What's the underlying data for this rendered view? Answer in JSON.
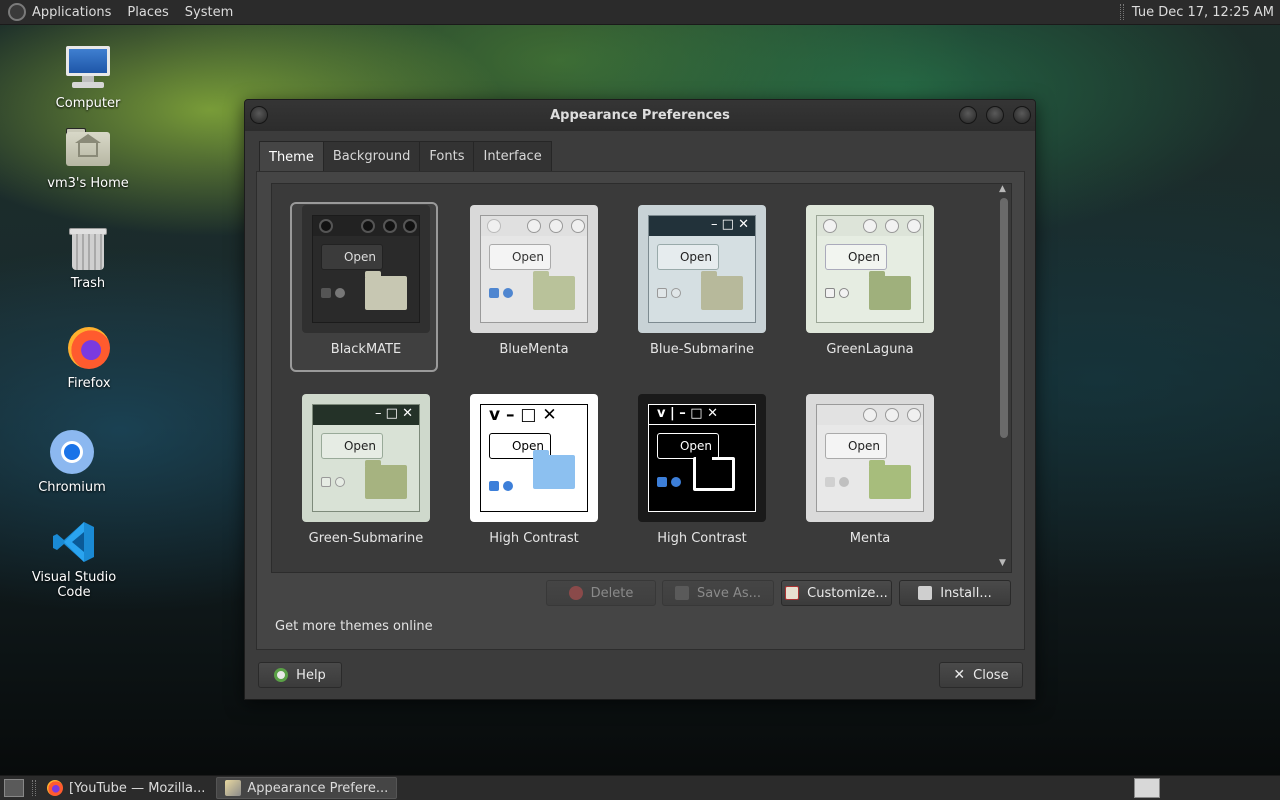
{
  "top_panel": {
    "menus": [
      "Applications",
      "Places",
      "System"
    ],
    "clock": "Tue Dec 17, 12:25 AM"
  },
  "desktop": {
    "icons": [
      {
        "label": "Computer",
        "icon": "computer-icon"
      },
      {
        "label": "vm3's Home",
        "icon": "home-folder-icon"
      },
      {
        "label": "Trash",
        "icon": "trash-icon"
      },
      {
        "label": "Firefox",
        "icon": "firefox-icon"
      },
      {
        "label": "Chromium",
        "icon": "chromium-icon"
      },
      {
        "label": "Visual Studio Code",
        "icon": "vscode-icon"
      }
    ]
  },
  "window": {
    "title": "Appearance Preferences",
    "tabs": [
      "Theme",
      "Background",
      "Fonts",
      "Interface"
    ],
    "active_tab": "Theme",
    "themes": [
      {
        "name": "BlackMATE",
        "selected": true,
        "open_label": "Open"
      },
      {
        "name": "BlueMenta",
        "selected": false,
        "open_label": "Open"
      },
      {
        "name": "Blue-Submarine",
        "selected": false,
        "open_label": "Open"
      },
      {
        "name": "GreenLaguna",
        "selected": false,
        "open_label": "Open"
      },
      {
        "name": "Green-Submarine",
        "selected": false,
        "open_label": "Open"
      },
      {
        "name": "High Contrast",
        "selected": false,
        "open_label": "Open"
      },
      {
        "name": "High Contrast",
        "selected": false,
        "open_label": "Open"
      },
      {
        "name": "Menta",
        "selected": false,
        "open_label": "Open"
      }
    ],
    "buttons": {
      "delete": "Delete",
      "save_as": "Save As...",
      "customize": "Customize...",
      "install": "Install..."
    },
    "more_themes": "Get more themes online",
    "help": "Help",
    "close": "Close"
  },
  "taskbar": {
    "tasks": [
      {
        "label": "[YouTube — Mozilla...",
        "icon": "firefox-icon",
        "active": false
      },
      {
        "label": "Appearance Prefere...",
        "icon": "appearance-icon",
        "active": true
      }
    ]
  },
  "colors": {
    "panel": "#2b2b2b",
    "window_bg": "#3c3c3c",
    "accent_blue": "#3d7fd9",
    "folder_green": "#a9b98a"
  }
}
